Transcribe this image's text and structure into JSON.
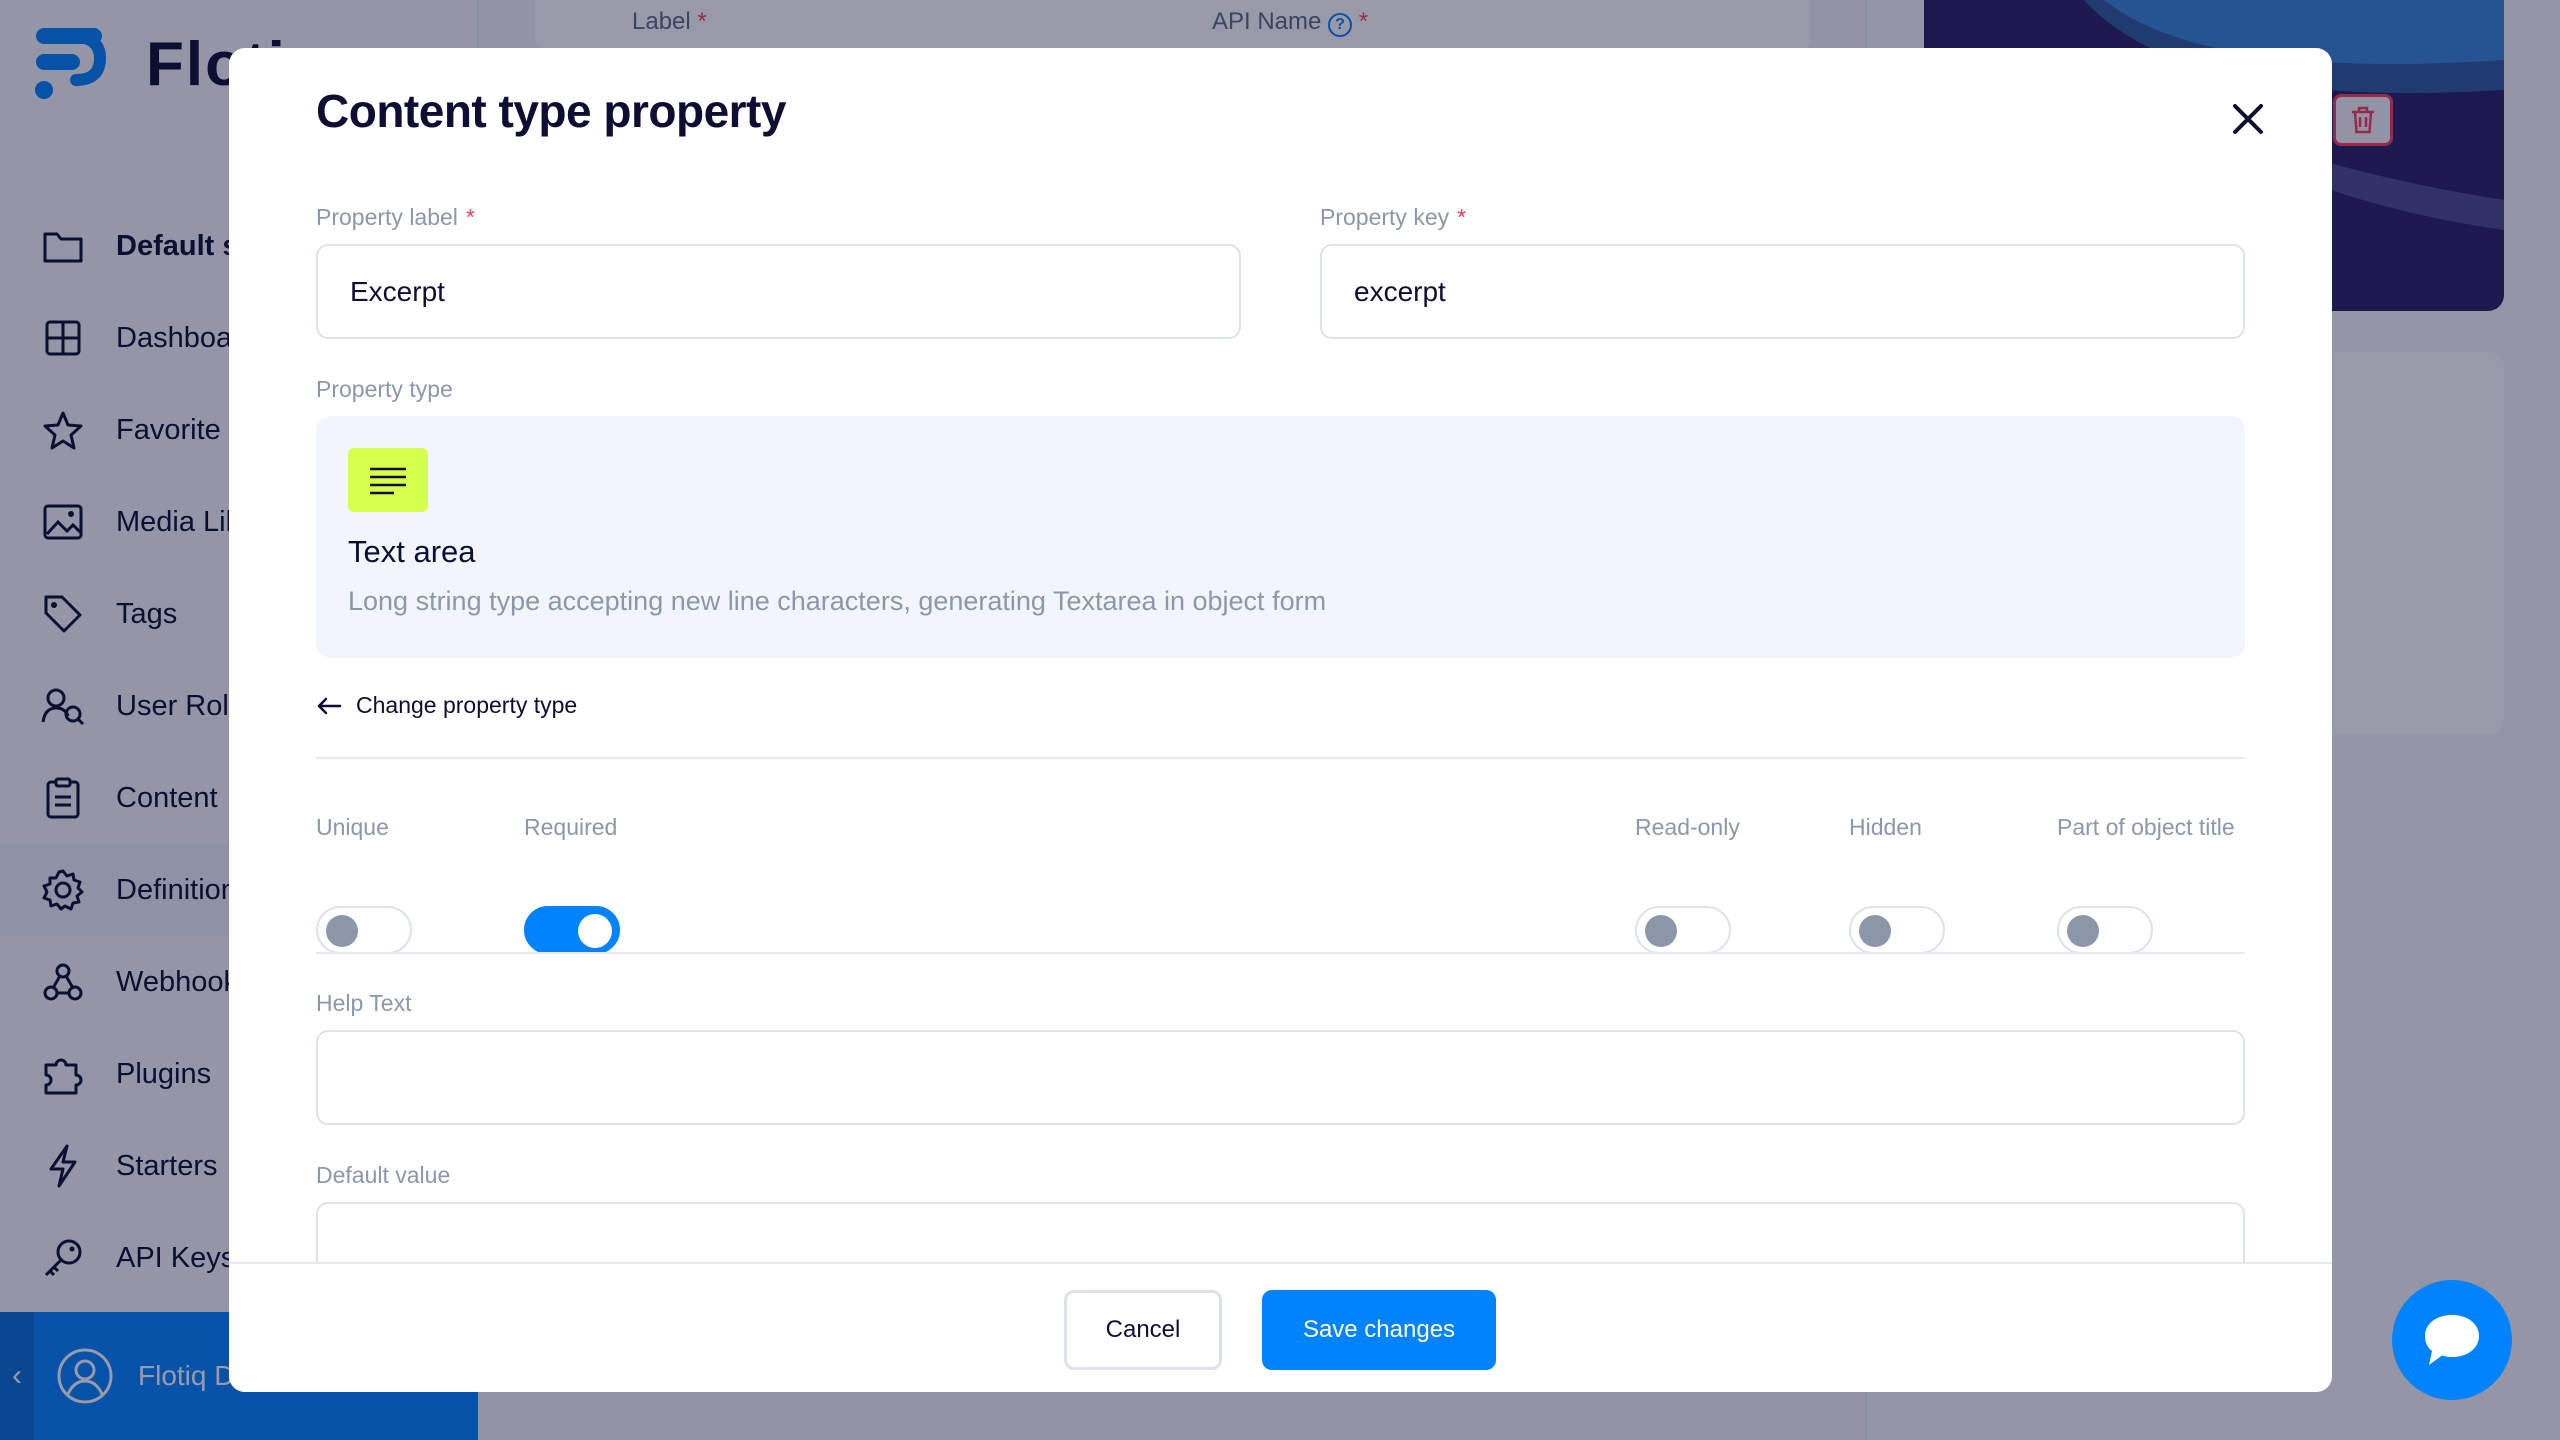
{
  "app": {
    "logo_text": "Flotiq",
    "sidebar": {
      "items": [
        {
          "label": "Default space",
          "icon": "folder-icon"
        },
        {
          "label": "Dashboard",
          "icon": "grid-icon"
        },
        {
          "label": "Favorite",
          "icon": "star-icon"
        },
        {
          "label": "Media Library",
          "icon": "image-icon"
        },
        {
          "label": "Tags",
          "icon": "tag-icon"
        },
        {
          "label": "User Roles",
          "icon": "users-icon"
        },
        {
          "label": "Content",
          "icon": "clipboard-icon"
        },
        {
          "label": "Definitions",
          "icon": "gear-icon"
        },
        {
          "label": "Webhooks",
          "icon": "webhook-icon"
        },
        {
          "label": "Plugins",
          "icon": "puzzle-icon"
        },
        {
          "label": "Starters",
          "icon": "bolt-icon"
        },
        {
          "label": "API Keys",
          "icon": "key-icon"
        }
      ],
      "user_name": "Flotiq Demo"
    },
    "background_form": {
      "label_field": "Label",
      "api_name_field": "API Name"
    }
  },
  "modal": {
    "title": "Content type property",
    "property_label": {
      "label": "Property label",
      "value": "Excerpt"
    },
    "property_key": {
      "label": "Property key",
      "value": "excerpt"
    },
    "property_type": {
      "label": "Property type",
      "name": "Text area",
      "description": "Long string type accepting new line characters, generating Textarea in object form",
      "icon": "text-lines-icon"
    },
    "change_type_link": "Change property type",
    "toggles": [
      {
        "label": "Unique",
        "on": false
      },
      {
        "label": "Required",
        "on": true
      },
      {
        "label": "Read-only",
        "on": false
      },
      {
        "label": "Hidden",
        "on": false
      },
      {
        "label": "Part of object title",
        "on": false
      }
    ],
    "help_text": {
      "label": "Help Text",
      "value": ""
    },
    "default_value": {
      "label": "Default value",
      "value": ""
    },
    "footer": {
      "cancel": "Cancel",
      "save": "Save changes"
    }
  },
  "colors": {
    "accent": "#0083fc",
    "required_star": "#ff3f56",
    "type_icon_bg": "#d6ff4b",
    "text_primary": "#0d0e32"
  }
}
